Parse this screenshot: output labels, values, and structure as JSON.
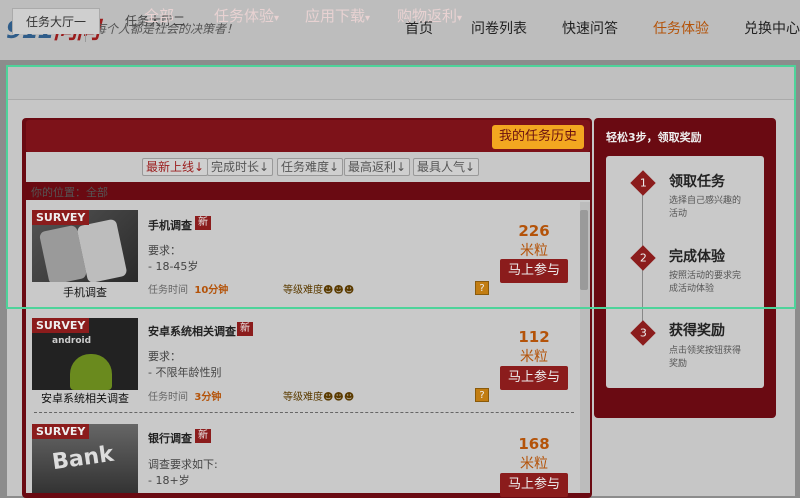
{
  "header": {
    "logo_a": "911",
    "logo_b": "问问",
    "slogan": "每个人都是社会的决策者！",
    "nav": [
      "首页",
      "问卷列表",
      "快速问答",
      "任务体验",
      "兑换中心"
    ]
  },
  "tabs": [
    "任务大厅一",
    "任务大厅二"
  ],
  "filters": {
    "all": "全部",
    "task": "任务体验",
    "app": "应用下载",
    "shop": "购物返利",
    "caret": "▾",
    "history": "我的任务历史"
  },
  "sort": [
    "最新上线",
    "完成时长",
    "任务难度",
    "最高返利",
    "最具人气"
  ],
  "sort_arrow": "↓",
  "breadcrumb": "你的位置：全部",
  "items": [
    {
      "survey": "SURVEY",
      "caption": "手机调查",
      "title": "手机调查",
      "new": "新",
      "req_label": "要求：",
      "req": "- 18-45岁",
      "time_label": "任务时间",
      "time": "10分钟",
      "diff_label": "等级难度",
      "price": "226",
      "unit": "米粒",
      "join": "马上参与",
      "help": "?"
    },
    {
      "survey": "SURVEY",
      "caption": "安卓系统相关调查",
      "title": "安卓系统相关调查",
      "new": "新",
      "req_label": "要求：",
      "req": "- 不限年龄性别",
      "time_label": "任务时间",
      "time": "3分钟",
      "diff_label": "等级难度",
      "price": "112",
      "unit": "米粒",
      "join": "马上参与",
      "help": "?"
    },
    {
      "survey": "SURVEY",
      "caption": "",
      "title": "银行调查",
      "new": "新",
      "req_label": "调查要求如下:",
      "req": "- 18+岁",
      "time_label": "",
      "time": "",
      "diff_label": "",
      "price": "168",
      "unit": "米粒",
      "join": "马上参与",
      "help": ""
    }
  ],
  "sidebar": {
    "title": "轻松3步，领取奖励",
    "steps": [
      {
        "num": "1",
        "title": "领取任务",
        "desc": "选择自己感兴趣的活动"
      },
      {
        "num": "2",
        "title": "完成体验",
        "desc": "按照活动的要求完成活动体验"
      },
      {
        "num": "3",
        "title": "获得奖励",
        "desc": "点击领奖按钮获得奖励"
      }
    ]
  }
}
